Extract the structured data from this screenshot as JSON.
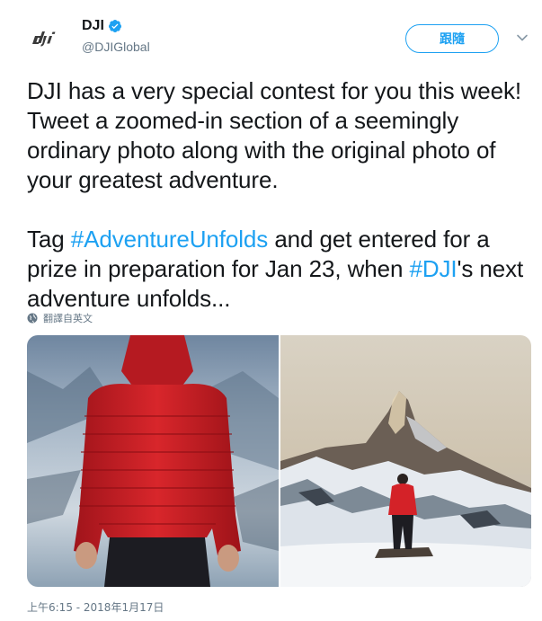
{
  "author": {
    "name": "DJI",
    "handle": "@DJIGlobal",
    "logo_icon": "dji-logo",
    "verified_icon": "verified-badge-icon",
    "verified_color": "#1da1f2"
  },
  "actions": {
    "follow_label": "跟隨",
    "more_icon": "chevron-down-icon"
  },
  "tweet": {
    "para1": "DJI has a very special contest for you this week! Tweet a zoomed-in section of a seemingly ordinary photo along with the original photo of your greatest adventure.",
    "para2_part1": "Tag ",
    "hashtag1": "#AdventureUnfolds",
    "para2_part2": " and get entered for a prize in preparation for Jan 23, when ",
    "hashtag2": "#DJI",
    "para2_part3": "'s next adventure unfolds...",
    "link_color": "#1da1f2"
  },
  "translate": {
    "label": "翻譯自英文",
    "icon": "globe-icon"
  },
  "media": {
    "left_alt": "zoomed-in red jacket",
    "right_alt": "person in red jacket facing mountain"
  },
  "timestamp": "上午6:15 - 2018年1月17日"
}
